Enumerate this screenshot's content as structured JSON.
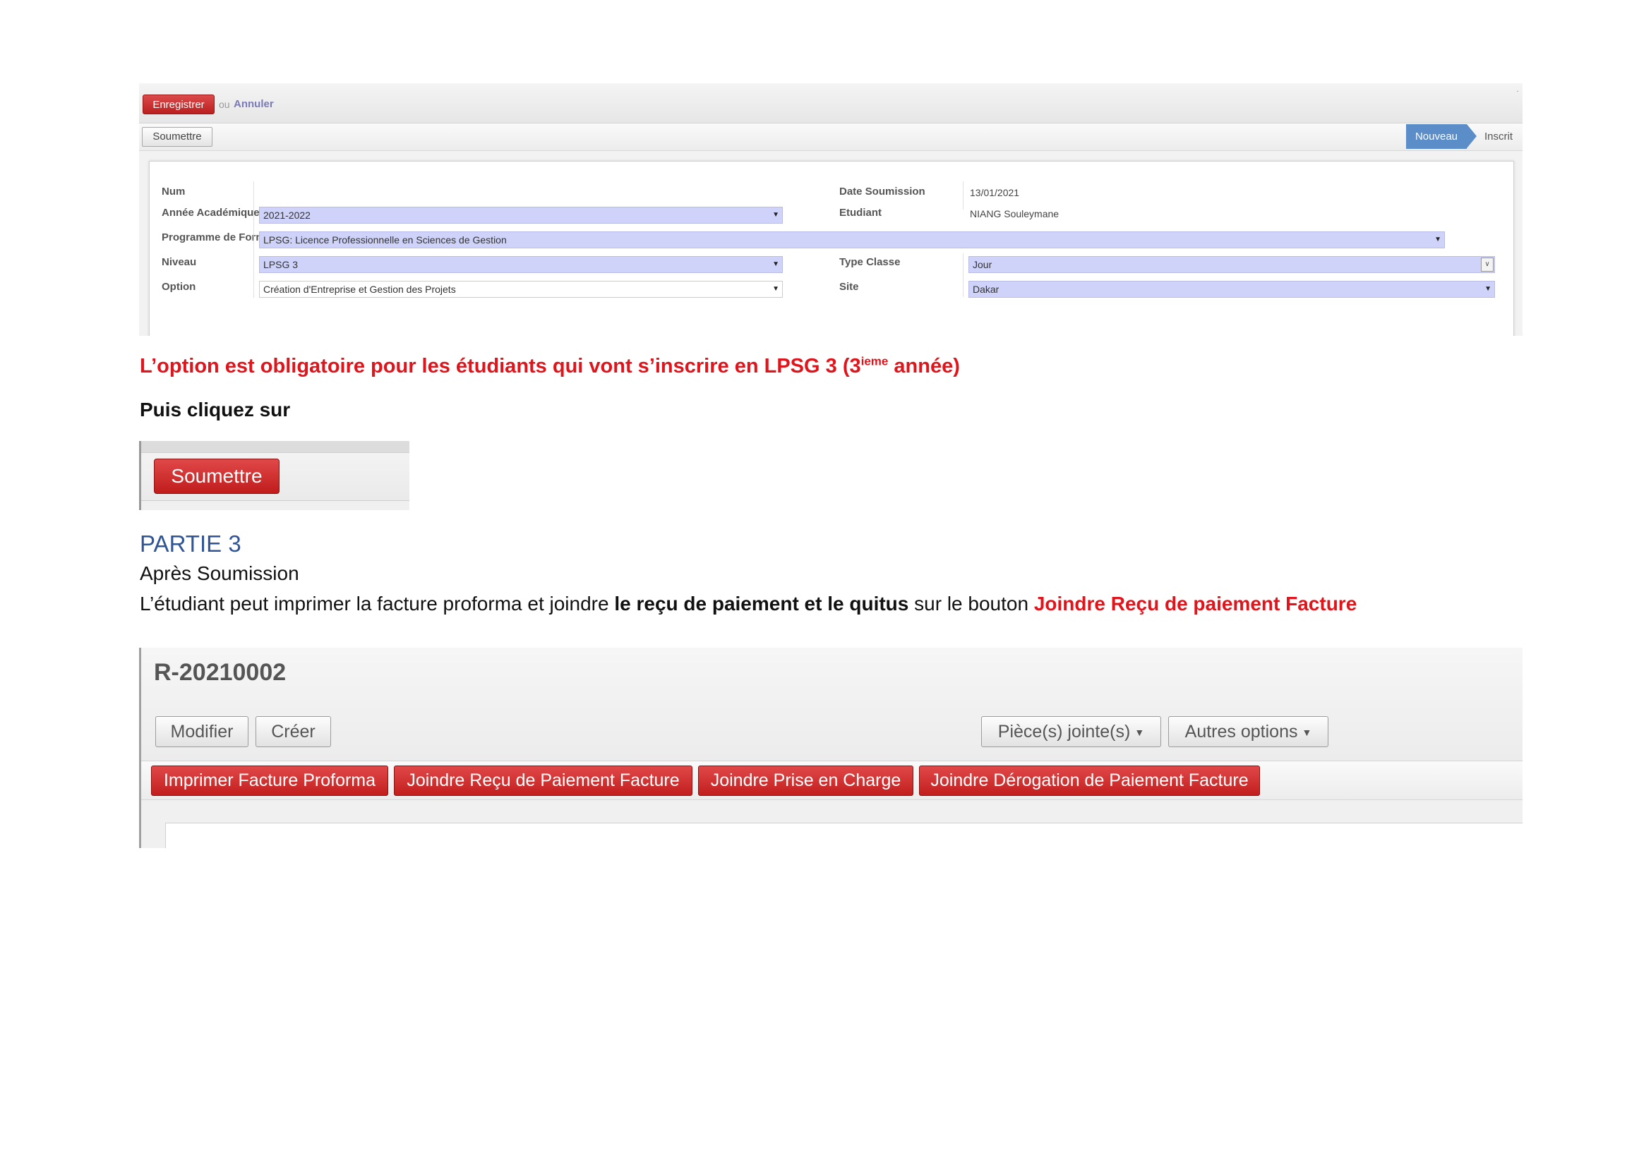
{
  "form": {
    "save_button": "Enregistrer",
    "or_text": "ou",
    "cancel_link": "Annuler",
    "submit_button": "Soumettre",
    "stages": {
      "current": "Nouveau",
      "next": "Inscrit"
    },
    "labels": {
      "num": "Num",
      "academic_year": "Année Académique",
      "program": "Programme de Formation",
      "level": "Niveau",
      "option": "Option",
      "submission_date": "Date Soumission",
      "student": "Etudiant",
      "class_type": "Type Classe",
      "site": "Site"
    },
    "values": {
      "num": "",
      "academic_year": "2021-2022",
      "program": "LPSG: Licence Professionnelle en Sciences de Gestion",
      "level": "LPSG 3",
      "option": "Création d'Entreprise et Gestion des Projets",
      "submission_date": "13/01/2021",
      "student": "NIANG Souleymane",
      "class_type": "Jour",
      "site": "Dakar"
    }
  },
  "text": {
    "warning_main": "L’option est obligatoire pour les étudiants qui vont s’inscrire en LPSG 3 (3",
    "warning_sup": "ieme",
    "warning_end": " année)",
    "then_click": "Puis cliquez sur",
    "submit_big": "Soumettre",
    "part_heading": "PARTIE 3",
    "after_submission": "Après Soumission",
    "line_a": "L’étudiant peut imprimer la facture proforma et joindre ",
    "line_b": "le reçu de paiement et le quitus",
    "line_c": " sur le bouton ",
    "line_d": "Joindre Reçu de paiement Facture"
  },
  "record": {
    "title": "R-20210002",
    "edit_button": "Modifier",
    "create_button": "Créer",
    "attachments_button": "Pièce(s) jointe(s)",
    "more_options_button": "Autres options",
    "actions": [
      "Imprimer Facture Proforma",
      "Joindre Reçu de Paiement Facture",
      "Joindre Prise en Charge",
      "Joindre Dérogation de Paiement Facture"
    ]
  },
  "icons": {
    "dropdown": "caret-down-icon"
  },
  "colors": {
    "accent_red": "#e0141a",
    "heading_blue": "#2f5597",
    "stage_blue": "#5b8dc9",
    "field_lavender": "#cfd3fa"
  }
}
